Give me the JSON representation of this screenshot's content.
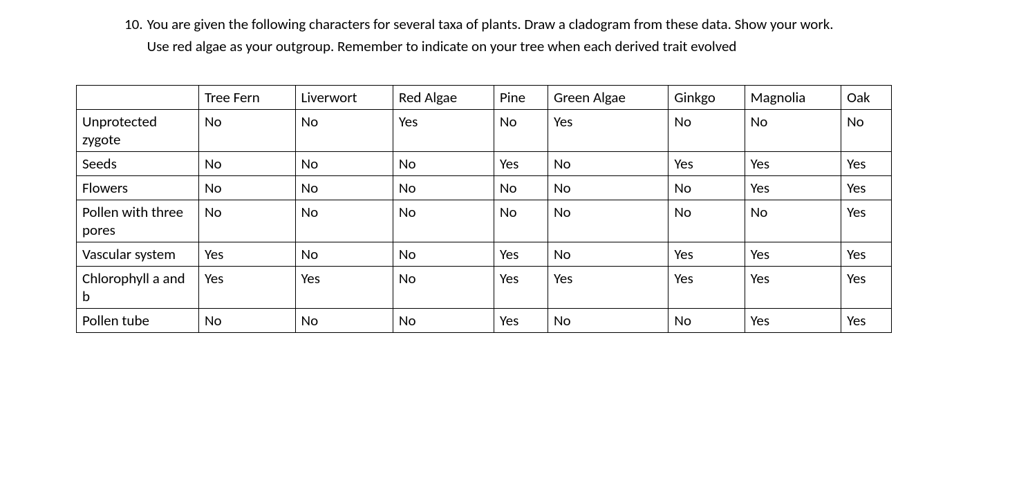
{
  "question": {
    "number": "10.",
    "text": "You are given the following characters for several taxa of plants.  Draw a cladogram from these data.  Show your work.  Use red algae as your outgroup. Remember to indicate on your tree when each derived trait evolved"
  },
  "chart_data": {
    "type": "table",
    "columns": [
      "Tree Fern",
      "Liverwort",
      "Red Algae",
      "Pine",
      "Green Algae",
      "Ginkgo",
      "Magnolia",
      "Oak"
    ],
    "rows": [
      {
        "label": "Unprotected zygote",
        "values": [
          "No",
          "No",
          "Yes",
          "No",
          "Yes",
          "No",
          "No",
          "No"
        ]
      },
      {
        "label": "Seeds",
        "values": [
          "No",
          "No",
          "No",
          "Yes",
          "No",
          "Yes",
          "Yes",
          "Yes"
        ]
      },
      {
        "label": "Flowers",
        "values": [
          "No",
          "No",
          "No",
          "No",
          "No",
          "No",
          "Yes",
          "Yes"
        ]
      },
      {
        "label": "Pollen with three pores",
        "values": [
          "No",
          "No",
          "No",
          "No",
          "No",
          "No",
          "No",
          "Yes"
        ]
      },
      {
        "label": "Vascular system",
        "values": [
          "Yes",
          "No",
          "No",
          "Yes",
          "No",
          "Yes",
          "Yes",
          "Yes"
        ]
      },
      {
        "label": "Chlorophyll a and b",
        "values": [
          "Yes",
          "Yes",
          "No",
          "Yes",
          "Yes",
          "Yes",
          "Yes",
          "Yes"
        ]
      },
      {
        "label": "Pollen tube",
        "values": [
          "No",
          "No",
          "No",
          "Yes",
          "No",
          "No",
          "Yes",
          "Yes"
        ]
      }
    ]
  }
}
